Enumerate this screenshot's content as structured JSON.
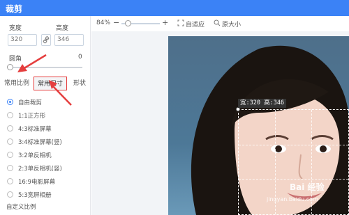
{
  "window": {
    "title": "裁剪",
    "accent": "#3b82f6"
  },
  "left_panel": {
    "width_label": "宽度",
    "width_value": "320",
    "height_label": "高度",
    "height_value": "346",
    "corner_label": "圆角",
    "corner_value": "0",
    "tabs": [
      {
        "label": "常用比例",
        "active": false
      },
      {
        "label": "常用尺寸",
        "active": true
      },
      {
        "label": "形状",
        "active": false
      }
    ],
    "options": [
      {
        "label": "自由裁剪",
        "selected": true
      },
      {
        "label": "1:1正方形",
        "selected": false
      },
      {
        "label": "4:3标准屏幕",
        "selected": false
      },
      {
        "label": "3:4标准屏幕(竖)",
        "selected": false
      },
      {
        "label": "3:2单反相机",
        "selected": false
      },
      {
        "label": "2:3单反相机(竖)",
        "selected": false
      },
      {
        "label": "16:9电影屏幕",
        "selected": false
      },
      {
        "label": "5:3宽屏相册",
        "selected": false
      }
    ],
    "custom_ratio": "自定义比例"
  },
  "toolbar": {
    "zoom": "84%",
    "minus": "−",
    "plus": "+",
    "fit": "自适应",
    "original": "原大小"
  },
  "canvas": {
    "size_label": "宽:320 高:346",
    "watermark": "Bai 经验",
    "watermark_sub": "jingyan.baidu.com"
  },
  "annotation_color": "#e53e3e"
}
